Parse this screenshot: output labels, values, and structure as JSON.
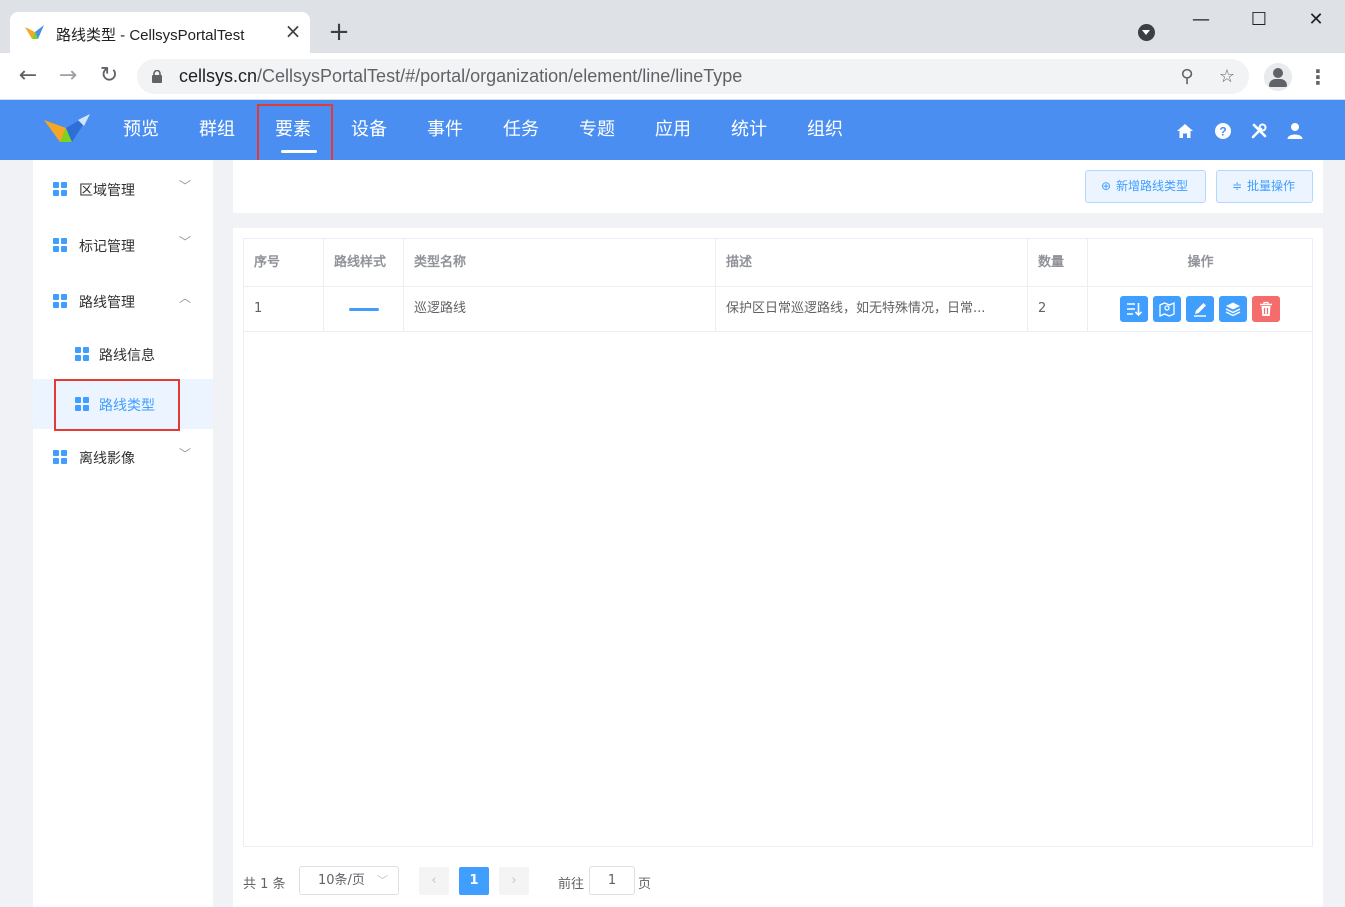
{
  "browser": {
    "tab_title": "路线类型 - CellsysPortalTest",
    "url_host": "cellsys.cn",
    "url_path": "/CellsysPortalTest/#/portal/organization/element/line/lineType"
  },
  "header": {
    "nav": [
      {
        "label": "预览"
      },
      {
        "label": "群组"
      },
      {
        "label": "要素",
        "active": true
      },
      {
        "label": "设备"
      },
      {
        "label": "事件"
      },
      {
        "label": "任务"
      },
      {
        "label": "专题"
      },
      {
        "label": "应用"
      },
      {
        "label": "统计"
      },
      {
        "label": "组织"
      }
    ],
    "icons": [
      "home-icon",
      "help-icon",
      "tools-icon",
      "user-icon"
    ]
  },
  "sidebar": {
    "items": [
      {
        "label": "区域管理",
        "expanded": false
      },
      {
        "label": "标记管理",
        "expanded": false
      },
      {
        "label": "路线管理",
        "expanded": true,
        "children": [
          {
            "label": "路线信息"
          },
          {
            "label": "路线类型",
            "active": true
          }
        ]
      },
      {
        "label": "离线影像",
        "expanded": false
      }
    ]
  },
  "actions": {
    "add_label": "新增路线类型",
    "batch_label": "批量操作"
  },
  "table": {
    "columns": [
      "序号",
      "路线样式",
      "类型名称",
      "描述",
      "数量",
      "操作"
    ],
    "rows": [
      {
        "index": "1",
        "style_color": "#409eff",
        "name": "巡逻路线",
        "description": "保护区日常巡逻路线，如无特殊情况，日常...",
        "count": "2",
        "operations": [
          "sort-icon",
          "map-icon",
          "edit-icon",
          "layers-icon",
          "delete-icon"
        ]
      }
    ]
  },
  "pagination": {
    "total": "共 1 条",
    "page_size": "10条/页",
    "current_page": "1",
    "goto_prefix": "前往",
    "goto_value": "1",
    "goto_suffix": "页"
  },
  "colors": {
    "header_bg": "#4a8ef2",
    "primary": "#409eff",
    "danger": "#f56c6c",
    "highlight_box": "#e53935"
  }
}
